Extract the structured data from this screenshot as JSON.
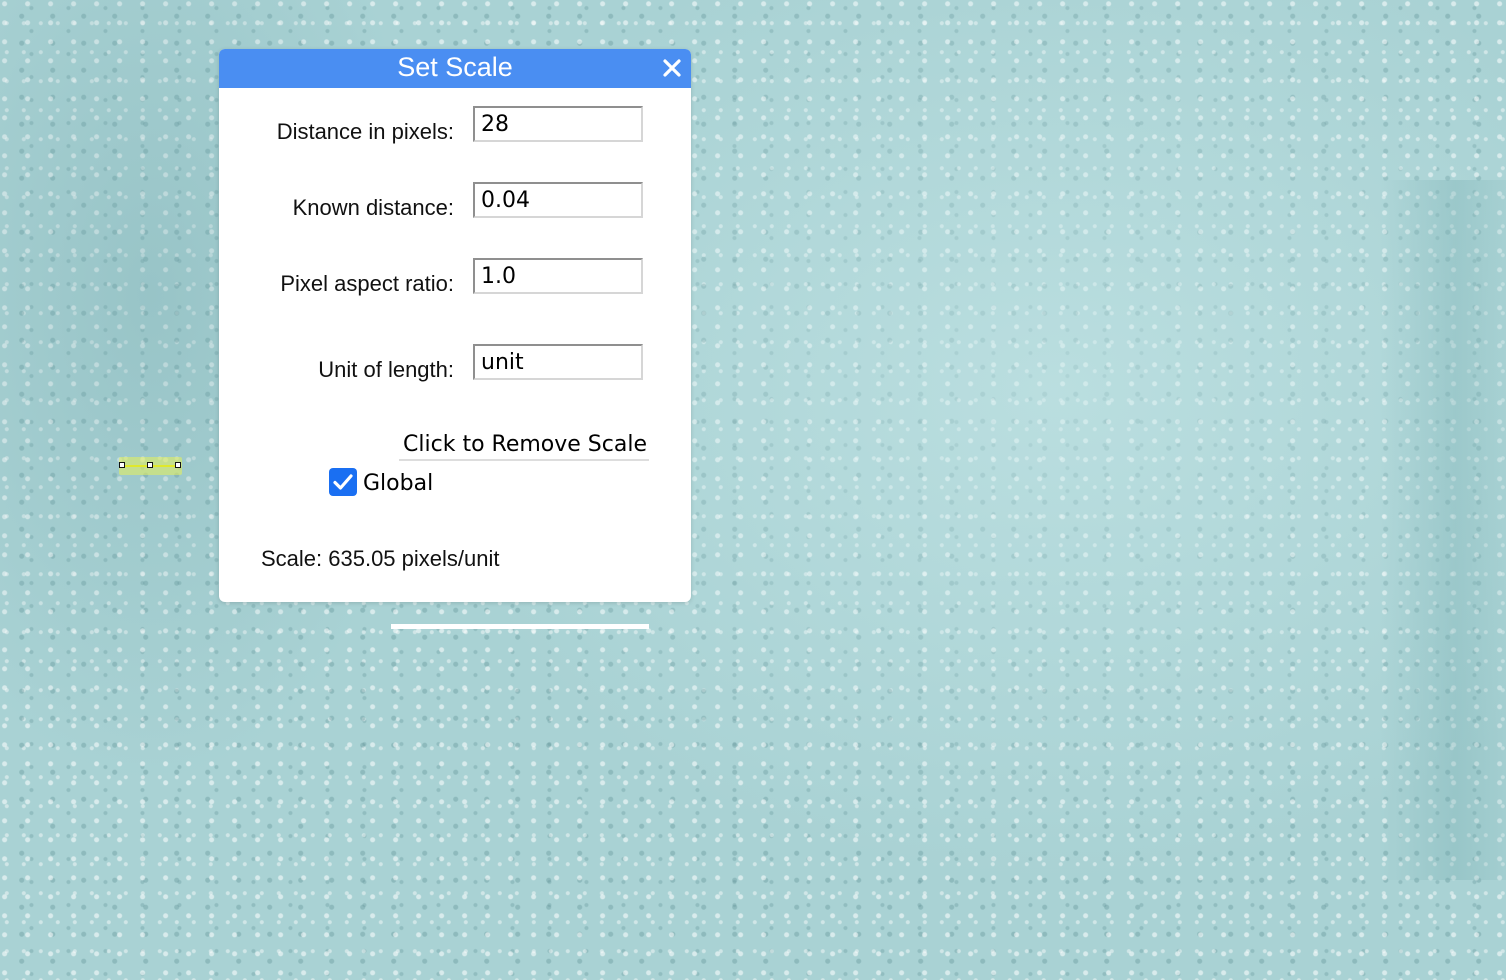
{
  "dialog": {
    "title": "Set Scale",
    "close_icon": "close-icon",
    "fields": [
      {
        "label": "Distance in pixels:",
        "value": "28"
      },
      {
        "label": "Known distance:",
        "value": "0.04"
      },
      {
        "label": "Pixel aspect ratio:",
        "value": "1.0"
      },
      {
        "label": "Unit of length:",
        "value": "unit"
      }
    ],
    "remove_scale_label": "Click to Remove Scale",
    "global": {
      "label": "Global",
      "checked": true
    },
    "scale_text": "Scale: 635.05 pixels/unit"
  },
  "colors": {
    "titlebar": "#4a8ef2",
    "checkbox": "#1a6ff2",
    "canvas": "#a9d2d4",
    "scale_marker": "#e0e82a"
  }
}
